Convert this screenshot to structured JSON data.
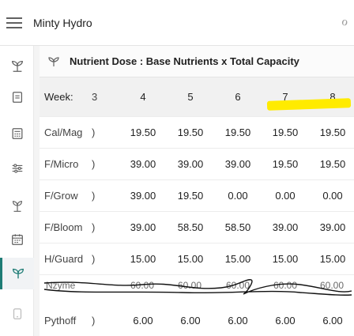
{
  "app": {
    "title": "Minty Hydro",
    "menu_icon": "hamburger-icon",
    "corner_icon": "tree-icon",
    "corner_glyph": "ℴ"
  },
  "sidebar": {
    "items": [
      {
        "icon": "sprout-icon"
      },
      {
        "icon": "notes-icon"
      },
      {
        "icon": "calculator-icon"
      },
      {
        "icon": "settings-sliders-icon"
      },
      {
        "icon": "plant-icon"
      },
      {
        "icon": "calendar-icon"
      },
      {
        "icon": "leaf-icon",
        "active": true
      },
      {
        "icon": "device-icon"
      }
    ]
  },
  "panel": {
    "title": "Nutrient Dose : Base Nutrients x Total Capacity",
    "title_icon": "leaf-icon"
  },
  "table": {
    "header_label": "Week:",
    "header_fragment": "3",
    "weeks": [
      "4",
      "5",
      "6",
      "7",
      "8"
    ],
    "rows": [
      {
        "label": "Cal/Mag",
        "fragment": ")",
        "values": [
          "19.50",
          "19.50",
          "19.50",
          "19.50",
          "19.50"
        ]
      },
      {
        "label": "F/Micro",
        "fragment": ")",
        "values": [
          "39.00",
          "39.00",
          "39.00",
          "19.50",
          "19.50"
        ]
      },
      {
        "label": "F/Grow",
        "fragment": ")",
        "values": [
          "39.00",
          "19.50",
          "0.00",
          "0.00",
          "0.00"
        ]
      },
      {
        "label": "F/Bloom",
        "fragment": ")",
        "values": [
          "39.00",
          "58.50",
          "58.50",
          "39.00",
          "39.00"
        ]
      },
      {
        "label": "H/Guard",
        "fragment": ")",
        "values": [
          "15.00",
          "15.00",
          "15.00",
          "15.00",
          "15.00"
        ]
      },
      {
        "label": "Pythoff",
        "fragment": ")",
        "values": [
          "6.00",
          "6.00",
          "6.00",
          "6.00",
          "6.00"
        ]
      }
    ],
    "struck_row": {
      "label": "Nzyme",
      "values": [
        "60.00",
        "60.00",
        "60.00",
        "60.00",
        "60.00"
      ]
    }
  },
  "colors": {
    "accent": "#1e7c75",
    "highlight": "#ffeb00",
    "header_bg": "#f1f1f1"
  }
}
